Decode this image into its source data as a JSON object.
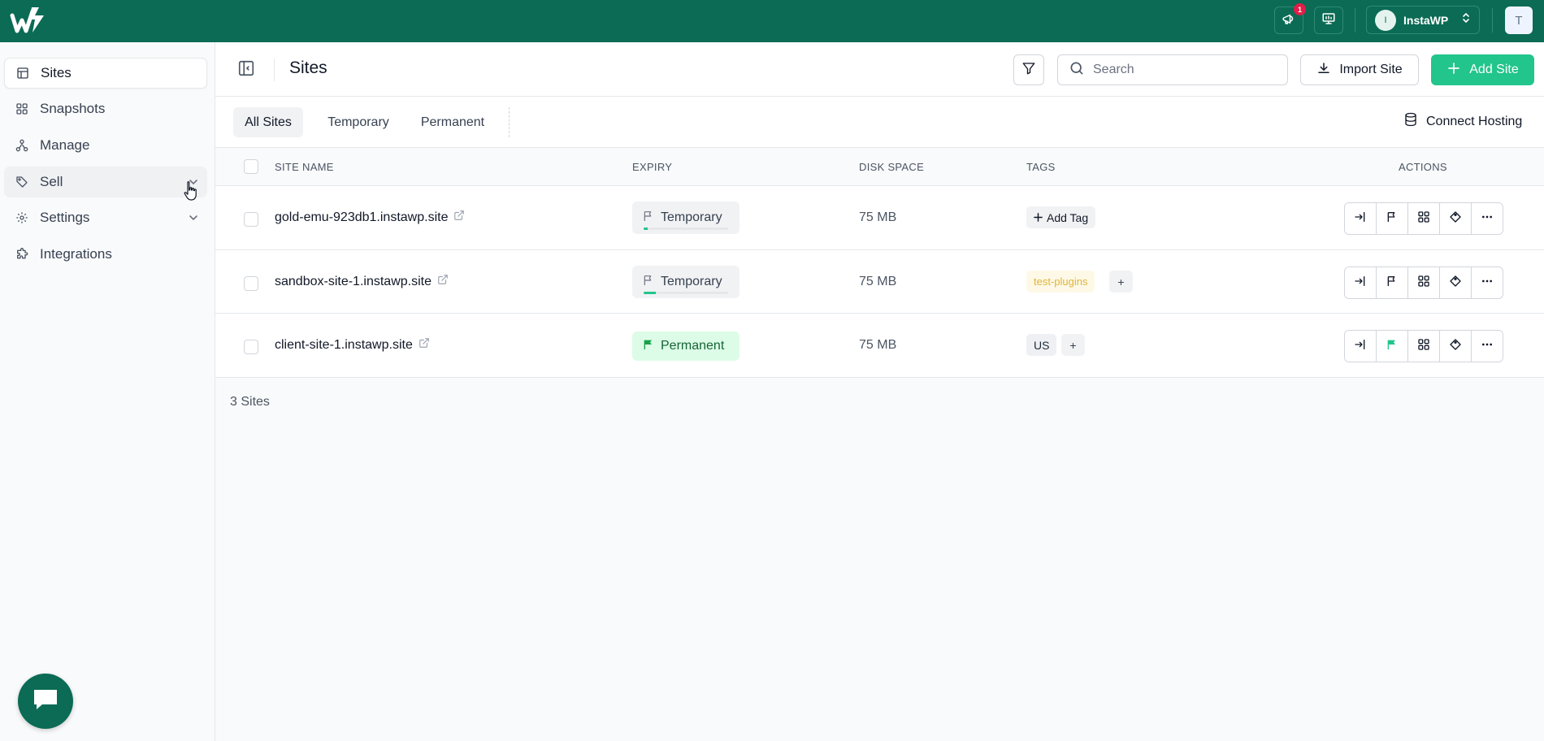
{
  "topbar": {
    "notification_count": "1",
    "team_initial": "I",
    "team_name": "InstaWP",
    "user_initial": "T"
  },
  "sidebar": {
    "items": [
      {
        "label": "Sites",
        "icon": "layout-icon"
      },
      {
        "label": "Snapshots",
        "icon": "grid-icon"
      },
      {
        "label": "Manage",
        "icon": "network-icon"
      },
      {
        "label": "Sell",
        "icon": "tag-icon"
      },
      {
        "label": "Settings",
        "icon": "gear-icon"
      },
      {
        "label": "Integrations",
        "icon": "puzzle-icon"
      }
    ]
  },
  "header": {
    "title": "Sites",
    "search_placeholder": "Search",
    "import_label": "Import Site",
    "add_label": "Add Site"
  },
  "tabs": {
    "all": "All Sites",
    "temporary": "Temporary",
    "permanent": "Permanent",
    "connect_hosting": "Connect Hosting"
  },
  "table": {
    "columns": {
      "site_name": "SITE NAME",
      "expiry": "EXPIRY",
      "disk_space": "DISK SPACE",
      "tags": "TAGS",
      "actions": "ACTIONS"
    },
    "rows": [
      {
        "name": "gold-emu-923db1.instawp.site",
        "expiry": "Temporary",
        "expiry_progress": 0.05,
        "disk": "75 MB",
        "tags": [],
        "add_tag_label": "Add Tag"
      },
      {
        "name": "sandbox-site-1.instawp.site",
        "expiry": "Temporary",
        "expiry_progress": 0.14,
        "disk": "75 MB",
        "tags": [
          "test-plugins"
        ],
        "plus_label": "+"
      },
      {
        "name": "client-site-1.instawp.site",
        "expiry": "Permanent",
        "disk": "75 MB",
        "tags": [
          "US"
        ],
        "plus_label": "+"
      }
    ]
  },
  "footer": {
    "count_label": "3 Sites"
  },
  "colors": {
    "brand": "#0b6b55",
    "accent": "#22c58b"
  }
}
